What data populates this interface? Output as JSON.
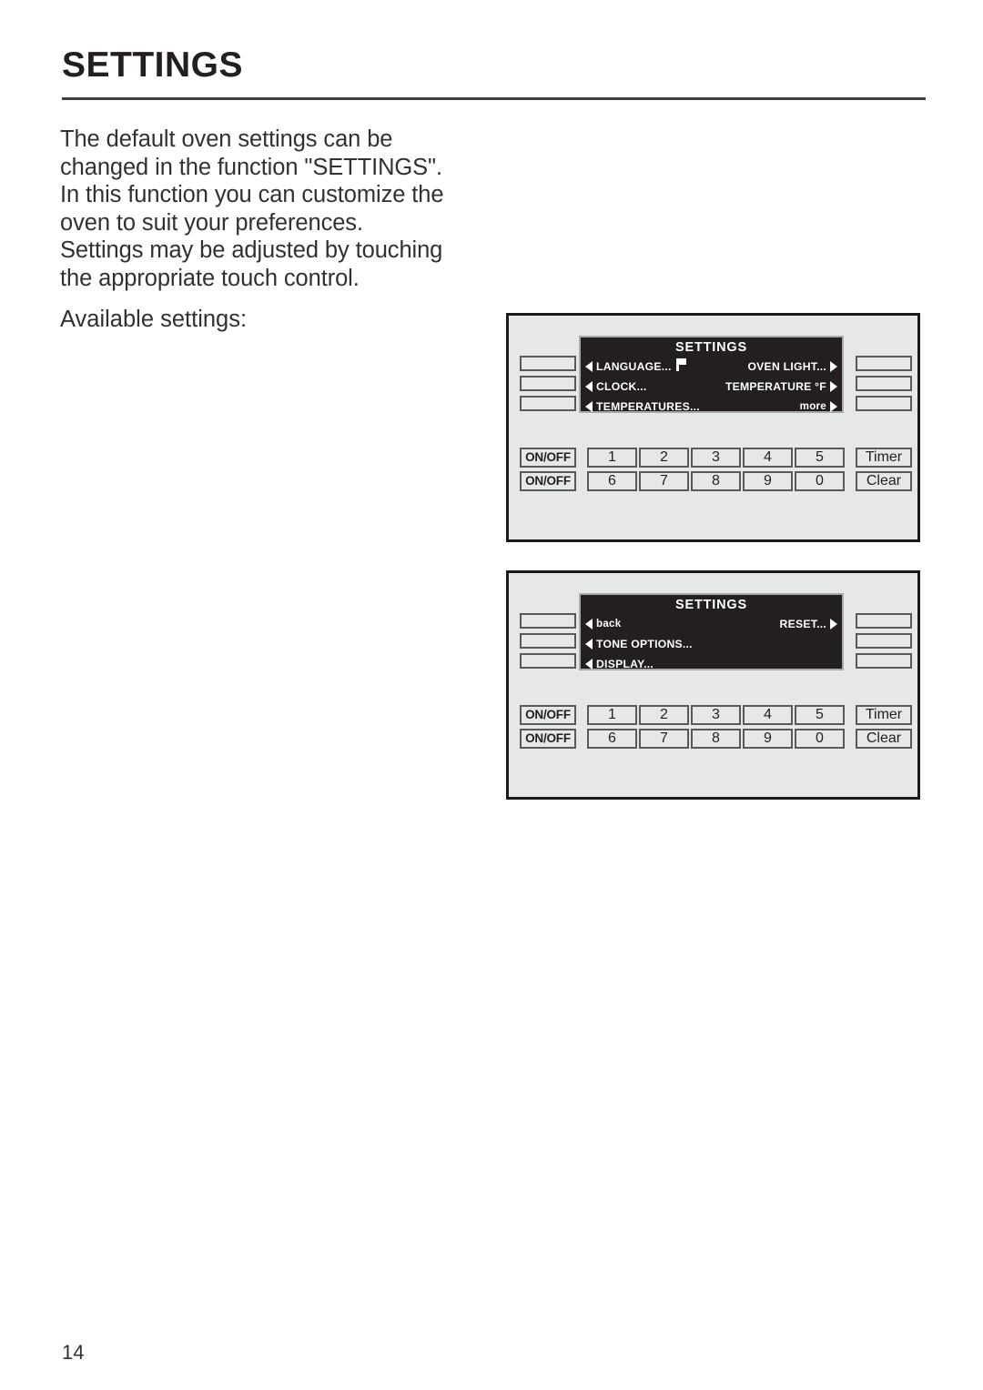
{
  "page": {
    "title": "SETTINGS",
    "folio": "14"
  },
  "intro": {
    "lines": [
      "The default oven settings can be",
      "changed in the function \"SETTINGS\".",
      "In this function you can customize the",
      "oven to suit your preferences.",
      "Settings may be adjusted by touching",
      "the appropriate touch control."
    ],
    "available_label": "Available settings:"
  },
  "panels": [
    {
      "id": "panel-1",
      "display": {
        "title": "SETTINGS",
        "rows": [
          {
            "left": "LANGUAGE...",
            "left_icon": "flag-icon",
            "right": "OVEN LIGHT...",
            "right_arrow": true,
            "left_arrow": true
          },
          {
            "left": "CLOCK...",
            "right": "TEMPERATURE °F",
            "right_arrow": true,
            "left_arrow": true
          },
          {
            "left": "TEMPERATURES...",
            "right": "more",
            "right_arrow": true,
            "left_arrow": true
          }
        ]
      },
      "keys": {
        "onoff": [
          "ON/OFF",
          "ON/OFF"
        ],
        "numbers_row1": [
          "1",
          "2",
          "3",
          "4",
          "5"
        ],
        "numbers_row2": [
          "6",
          "7",
          "8",
          "9",
          "0"
        ],
        "functions": [
          "Timer",
          "Clear"
        ]
      }
    },
    {
      "id": "panel-2",
      "display": {
        "title": "SETTINGS",
        "rows": [
          {
            "left": "back",
            "left_lower": true,
            "right": "RESET...",
            "right_arrow": true,
            "left_arrow": true
          },
          {
            "left": "TONE OPTIONS...",
            "right": "",
            "right_arrow": false,
            "left_arrow": true
          },
          {
            "left": "DISPLAY...",
            "right": "",
            "right_arrow": false,
            "left_arrow": true
          }
        ]
      },
      "keys": {
        "onoff": [
          "ON/OFF",
          "ON/OFF"
        ],
        "numbers_row1": [
          "1",
          "2",
          "3",
          "4",
          "5"
        ],
        "numbers_row2": [
          "6",
          "7",
          "8",
          "9",
          "0"
        ],
        "functions": [
          "Timer",
          "Clear"
        ]
      }
    }
  ],
  "colors": {
    "panel_bg": "#e6e7e8",
    "panel_border": "#1a1a1a",
    "display_bg": "#231f20",
    "display_frame": "#a7a9ac",
    "key_border": "#58595b",
    "text": "#231f20"
  }
}
